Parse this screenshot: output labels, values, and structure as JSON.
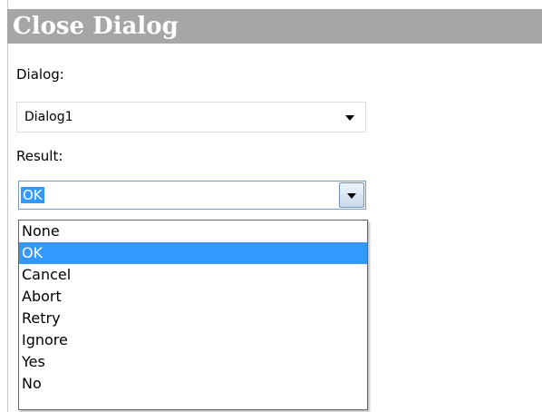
{
  "title": "Close Dialog",
  "dialog": {
    "label": "Dialog:",
    "value": "Dialog1"
  },
  "result": {
    "label": "Result:",
    "value": "OK",
    "options": [
      "None",
      "OK",
      "Cancel",
      "Abort",
      "Retry",
      "Ignore",
      "Yes",
      "No"
    ],
    "selected_option": "OK"
  },
  "colors": {
    "title_bg": "#a6a6a6",
    "selection": "#3399ff"
  }
}
